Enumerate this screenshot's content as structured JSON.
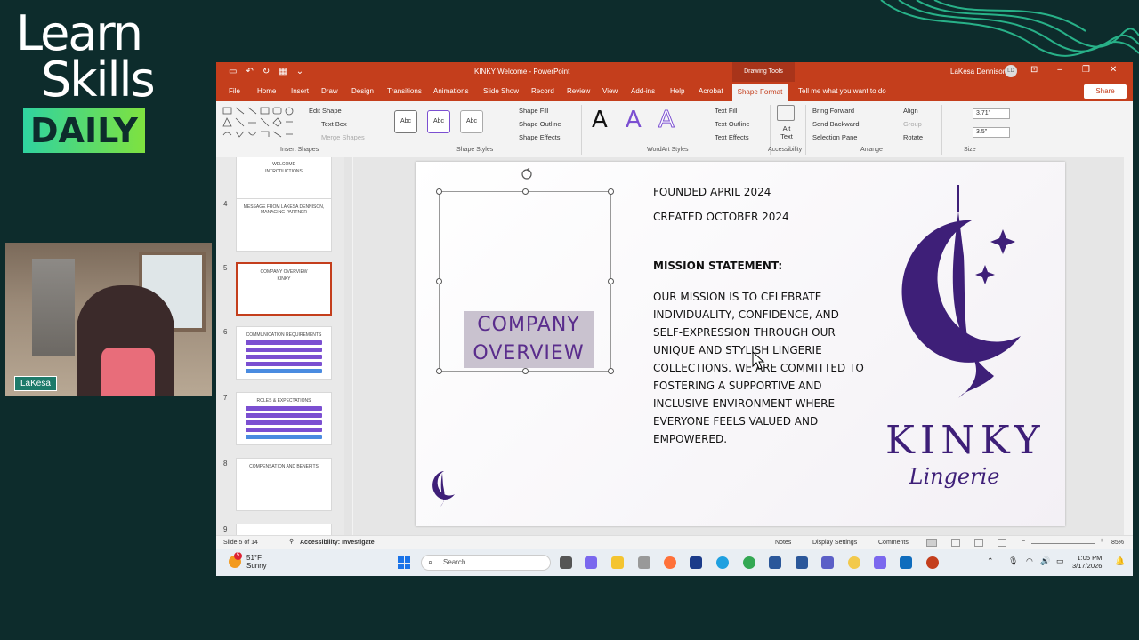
{
  "brand": {
    "line1": "Learn",
    "line2": "Skills",
    "line3": "DAILY"
  },
  "webcam": {
    "name": "LaKesa"
  },
  "window": {
    "title": "KINKY Welcome  -  PowerPoint",
    "context_group": "Drawing Tools",
    "user": "LaKesa Dennison",
    "user_initials": "LD"
  },
  "tabs": [
    "File",
    "Home",
    "Insert",
    "Draw",
    "Design",
    "Transitions",
    "Animations",
    "Slide Show",
    "Record",
    "Review",
    "View",
    "Add-ins",
    "Help",
    "Acrobat"
  ],
  "active_tab": "Shape Format",
  "tell_me": "Tell me what you want to do",
  "share": "Share",
  "ribbon": {
    "insert_shapes": {
      "label": "Insert Shapes",
      "edit_shape": "Edit Shape",
      "text_box": "Text Box",
      "merge_shapes": "Merge Shapes"
    },
    "shape_styles": {
      "label": "Shape Styles",
      "sample": "Abc",
      "fill": "Shape Fill",
      "outline": "Shape Outline",
      "effects": "Shape Effects"
    },
    "wordart": {
      "label": "WordArt Styles",
      "glyph": "A",
      "text_fill": "Text Fill",
      "text_outline": "Text Outline",
      "text_effects": "Text Effects"
    },
    "accessibility": {
      "label": "Accessibility",
      "alt_text": "Alt Text"
    },
    "arrange": {
      "label": "Arrange",
      "bring_forward": "Bring Forward",
      "send_backward": "Send Backward",
      "selection_pane": "Selection Pane",
      "align": "Align",
      "group": "Group",
      "rotate": "Rotate"
    },
    "size": {
      "label": "Size",
      "height": "3.71\"",
      "width": "3.5\""
    }
  },
  "thumbnails": [
    {
      "num": "",
      "texts": [
        "WELCOME",
        "INTRODUCTIONS"
      ]
    },
    {
      "num": "4",
      "texts": [
        "MESSAGE FROM LAKESA DENNISON, MANAGING PARTNER"
      ]
    },
    {
      "num": "5",
      "texts": [
        "COMPANY OVERVIEW",
        "KINKY"
      ]
    },
    {
      "num": "6",
      "texts": [
        "COMMUNICATION REQUIREMENTS"
      ]
    },
    {
      "num": "7",
      "texts": [
        "ROLES & EXPECTATIONS"
      ]
    },
    {
      "num": "8",
      "texts": [
        "COMPENSATION AND BENEFITS"
      ]
    },
    {
      "num": "9",
      "texts": []
    }
  ],
  "slide": {
    "title": "COMPANY OVERVIEW",
    "founded": "FOUNDED APRIL 2024",
    "created": "CREATED OCTOBER 2024",
    "mission_heading": "MISSION STATEMENT:",
    "mission_body": "OUR MISSION IS TO CELEBRATE INDIVIDUALITY, CONFIDENCE, AND SELF-EXPRESSION THROUGH OUR UNIQUE AND STYLISH LINGERIE COLLECTIONS. WE ARE COMMITTED TO FOSTERING A SUPPORTIVE AND INCLUSIVE ENVIRONMENT WHERE EVERYONE FEELS VALUED AND EMPOWERED.",
    "brand_name": "KINKY",
    "brand_sub": "Lingerie",
    "brand_color": "#3e1f78"
  },
  "status": {
    "slide": "Slide 5 of 14",
    "accessibility": "Accessibility: Investigate",
    "notes": "Notes",
    "display": "Display Settings",
    "comments": "Comments",
    "zoom": "85%"
  },
  "taskbar": {
    "temp": "51°F",
    "weather": "Sunny",
    "search": "Search",
    "time": "1:05 PM",
    "date": "3/17/2026",
    "badge": "5"
  },
  "colors": {
    "ppt_accent": "#c43e1c",
    "bg": "#0d2c2c"
  }
}
